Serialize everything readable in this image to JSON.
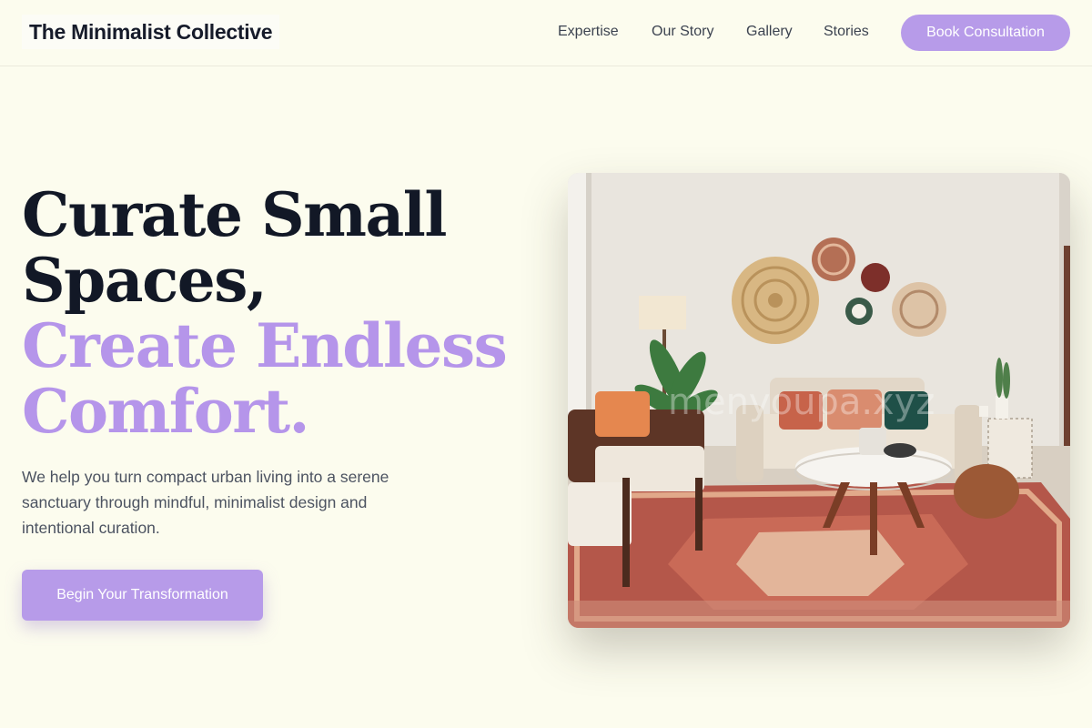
{
  "brand": {
    "name": "The Minimalist Collective"
  },
  "nav": {
    "items": [
      {
        "label": "Expertise"
      },
      {
        "label": "Our Story"
      },
      {
        "label": "Gallery"
      },
      {
        "label": "Stories"
      }
    ],
    "cta_label": "Book Consultation"
  },
  "hero": {
    "title_line1": "Curate Small",
    "title_line2": "Spaces,",
    "title_line3": "Create Endless",
    "title_line4": "Comfort.",
    "description": "We help you turn compact urban living into a serene sanctuary through mindful, minimalist design and intentional curation.",
    "cta_label": "Begin Your Transformation",
    "image_watermark": "menyoupa.xyz"
  },
  "colors": {
    "background": "#fcfcee",
    "accent": "#b79be9",
    "heading": "#121826",
    "accent_text": "#b595ea",
    "body_text": "#4c5361"
  }
}
